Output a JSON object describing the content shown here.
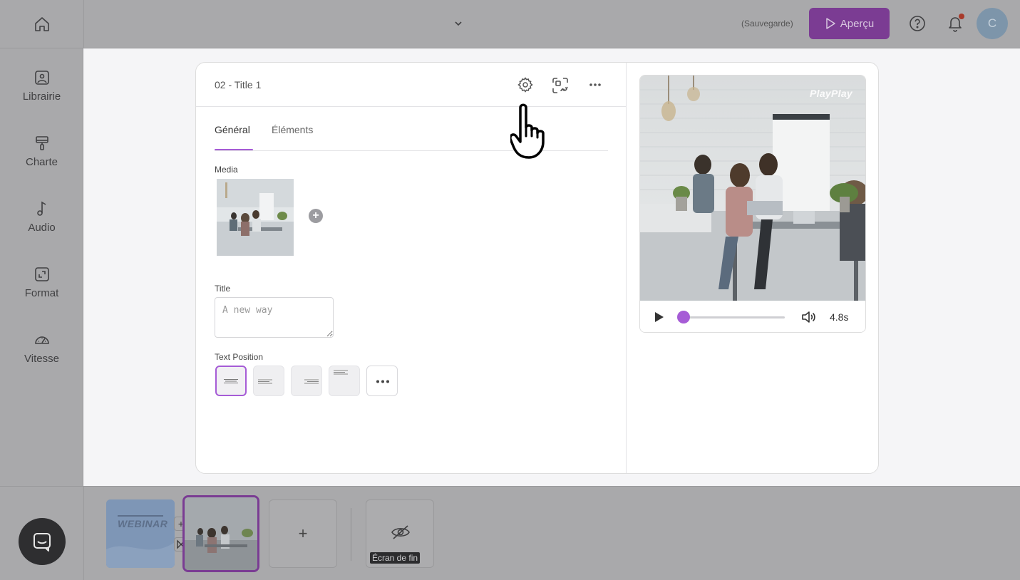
{
  "topbar": {
    "home_icon": "home-icon",
    "project_dropdown_icon": "chevron-down-icon",
    "save_status": "(Sauvegarde)",
    "preview_button": "Aperçu",
    "help_icon": "help-circle-icon",
    "notification_icon": "bell-icon",
    "avatar_initial": "C"
  },
  "sidebar": {
    "items": [
      {
        "label": "Librairie",
        "icon": "image-icon"
      },
      {
        "label": "Charte",
        "icon": "paint-roller-icon"
      },
      {
        "label": "Audio",
        "icon": "music-note-icon"
      },
      {
        "label": "Format",
        "icon": "resize-icon"
      },
      {
        "label": "Vitesse",
        "icon": "speedometer-icon"
      }
    ]
  },
  "editor": {
    "scene_title": "02 - Title 1",
    "header_icons": [
      "gear-icon",
      "swap-icon",
      "more-horizontal-icon"
    ],
    "tabs": [
      {
        "label": "Général",
        "active": true
      },
      {
        "label": "Éléments",
        "active": false
      }
    ],
    "media_label": "Media",
    "title_label": "Title",
    "title_placeholder": "A new way",
    "text_position_label": "Text Position",
    "text_positions": [
      "center",
      "left",
      "right",
      "top-left",
      "more"
    ],
    "selected_text_position": "center"
  },
  "preview": {
    "brand": "PlayPlay",
    "duration": "4.8s",
    "progress": 0.0
  },
  "timeline": {
    "slide1_text": "WEBINAR",
    "add_slide": "+",
    "end_screen_label": "Écran de fin"
  },
  "colors": {
    "accent": "#a65cd6",
    "preview_button_bg": "#7b3c93",
    "overlay_gray": "#a9a9ab"
  }
}
